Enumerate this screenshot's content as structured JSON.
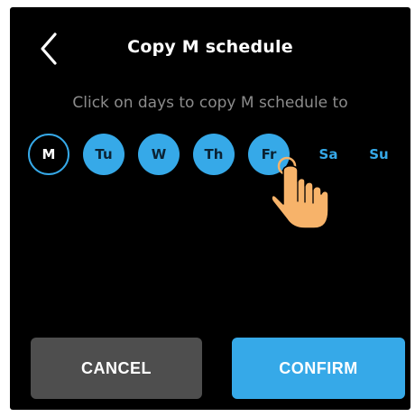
{
  "header": {
    "title": "Copy M schedule",
    "back_icon": "chevron-left-icon"
  },
  "instruction": "Click on days to copy M schedule to",
  "days": [
    {
      "label": "M",
      "state": "current"
    },
    {
      "label": "Tu",
      "state": "selected"
    },
    {
      "label": "W",
      "state": "selected"
    },
    {
      "label": "Th",
      "state": "selected"
    },
    {
      "label": "Fr",
      "state": "selected"
    },
    {
      "label": "Sa",
      "state": "unselected"
    },
    {
      "label": "Su",
      "state": "unselected"
    }
  ],
  "pointer_icon": "tap-hand-icon",
  "buttons": {
    "cancel_label": "CANCEL",
    "confirm_label": "CONFIRM"
  },
  "colors": {
    "accent": "#36a9e8",
    "background": "#000000",
    "cancel_bg": "#4e4e4e",
    "hand": "#f7b36a"
  }
}
